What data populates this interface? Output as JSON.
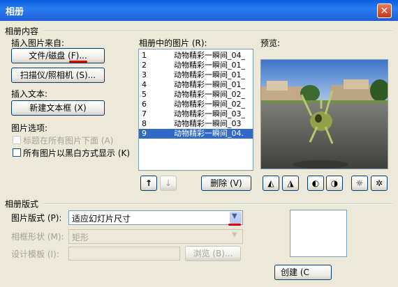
{
  "window": {
    "title": "相册",
    "close": "✕"
  },
  "album_content": {
    "heading": "相册内容",
    "insert_from_label": "插入图片来自:",
    "file_disk_button": "文件/磁盘 (F)...",
    "scanner_button": "扫描仪/照相机 (S)...",
    "insert_text_label": "插入文本:",
    "new_textbox_button": "新建文本框 (X)",
    "picture_options_label": "图片选项:",
    "captions_below_all": "标题在所有图片下面 (A)",
    "all_black_white": "所有图片以黑白方式显示 (K)"
  },
  "pictures": {
    "label": "相册中的图片 (R):",
    "items": [
      {
        "num": "1",
        "name": "动物精彩一瞬间_04_"
      },
      {
        "num": "2",
        "name": "动物精彩一瞬间_01_"
      },
      {
        "num": "3",
        "name": "动物精彩一瞬间_01_"
      },
      {
        "num": "4",
        "name": "动物精彩一瞬间_01_"
      },
      {
        "num": "5",
        "name": "动物精彩一瞬间_02_"
      },
      {
        "num": "6",
        "name": "动物精彩一瞬间_02_"
      },
      {
        "num": "7",
        "name": "动物精彩一瞬间_03_"
      },
      {
        "num": "8",
        "name": "动物精彩一瞬间_03"
      },
      {
        "num": "9",
        "name": "动物精彩一瞬间_04."
      }
    ],
    "selected_index": 8,
    "move_up": "↑",
    "move_down": "↓",
    "delete_button": "删除 (V)"
  },
  "preview": {
    "label": "预览:"
  },
  "layout": {
    "heading": "相册版式",
    "picture_layout_label": "图片版式 (P):",
    "picture_layout_value": "适应幻灯片尺寸",
    "frame_shape_label": "相框形状 (M):",
    "frame_shape_value": "矩形",
    "design_template_label": "设计模板 (I):",
    "browse_button": "浏览 (B)..."
  },
  "create_button": "创建 (C"
}
